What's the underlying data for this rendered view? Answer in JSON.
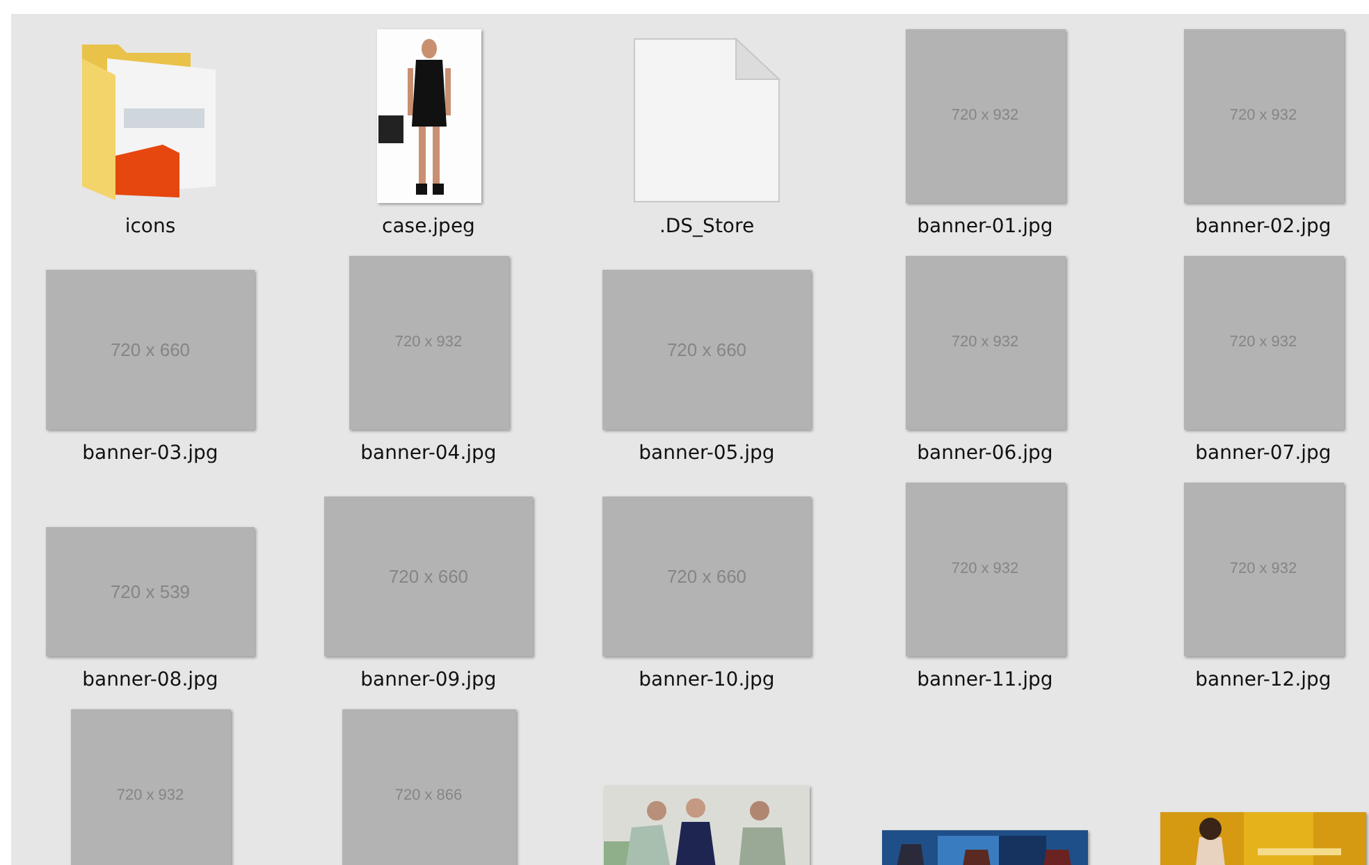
{
  "items": [
    {
      "kind": "folder",
      "label": "icons"
    },
    {
      "kind": "figure",
      "label": "case.jpeg"
    },
    {
      "kind": "file",
      "label": ".DS_Store"
    },
    {
      "kind": "tall",
      "label": "banner-01.jpg",
      "dimensions": "720 x 932"
    },
    {
      "kind": "tall",
      "label": "banner-02.jpg",
      "dimensions": "720 x 932"
    },
    {
      "kind": "wide",
      "label": "banner-03.jpg",
      "dimensions": "720 x 660"
    },
    {
      "kind": "tall",
      "label": "banner-04.jpg",
      "dimensions": "720 x 932"
    },
    {
      "kind": "wide",
      "label": "banner-05.jpg",
      "dimensions": "720 x 660"
    },
    {
      "kind": "tall",
      "label": "banner-06.jpg",
      "dimensions": "720 x 932"
    },
    {
      "kind": "tall",
      "label": "banner-07.jpg",
      "dimensions": "720 x 932"
    },
    {
      "kind": "low",
      "label": "banner-08.jpg",
      "dimensions": "720 x 539"
    },
    {
      "kind": "wide",
      "label": "banner-09.jpg",
      "dimensions": "720 x 660"
    },
    {
      "kind": "wide",
      "label": "banner-10.jpg",
      "dimensions": "720 x 660"
    },
    {
      "kind": "tall",
      "label": "banner-11.jpg",
      "dimensions": "720 x 932"
    },
    {
      "kind": "tall",
      "label": "banner-12.jpg",
      "dimensions": "720 x 932"
    },
    {
      "kind": "tall",
      "dimensions": "720 x 932"
    },
    {
      "kind": "square",
      "dimensions": "720 x 866"
    },
    {
      "kind": "group"
    },
    {
      "kind": "strip"
    },
    {
      "kind": "promo"
    }
  ]
}
